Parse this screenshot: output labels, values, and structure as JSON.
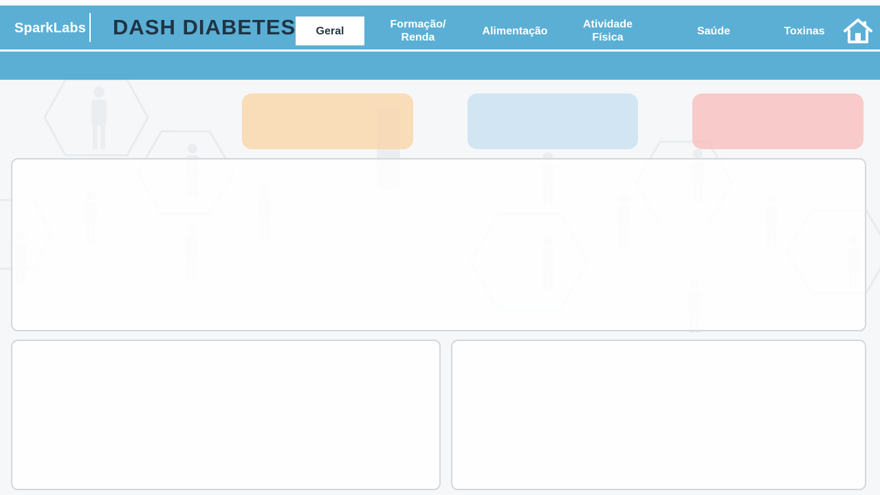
{
  "brand": {
    "name": "SparkLabs"
  },
  "title": "DASH DIABETES",
  "nav": {
    "items": [
      {
        "label": "Geral",
        "active": true
      },
      {
        "label": "Formação/\nRenda",
        "active": false
      },
      {
        "label": "Alimentação",
        "active": false
      },
      {
        "label": "Atividade\nFísica",
        "active": false
      },
      {
        "label": "Saúde",
        "active": false
      },
      {
        "label": "Toxinas",
        "active": false
      }
    ],
    "home_icon": "home-icon"
  },
  "colors": {
    "header": "#5bafd5",
    "title_text": "#1f3444",
    "kpi_orange": "#f9d6aa",
    "kpi_blue": "#c8e1f0",
    "kpi_red": "#f8c0be"
  },
  "icons": {
    "background": "person-silhouette-icon"
  }
}
